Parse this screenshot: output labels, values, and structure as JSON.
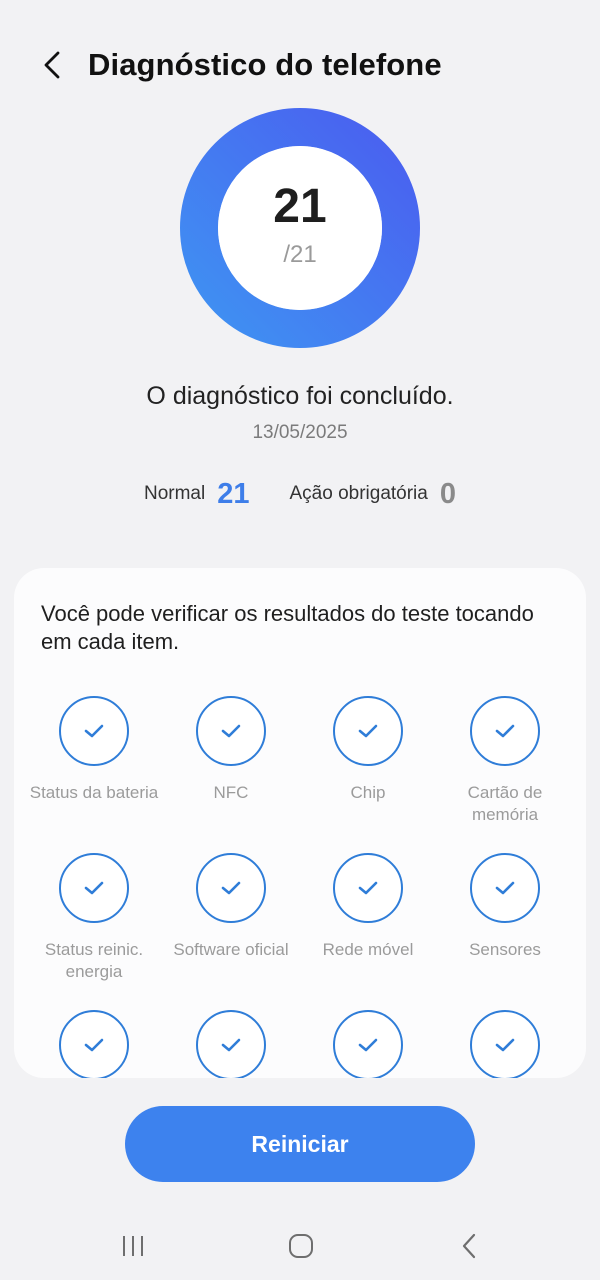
{
  "header": {
    "title": "Diagnóstico do telefone",
    "back_icon": "chevron-left-icon"
  },
  "summary": {
    "score": "21",
    "total": "/21",
    "progress": 1.0,
    "status": "O diagnóstico foi concluído.",
    "date": "13/05/2025",
    "normal_label": "Normal",
    "normal_count": "21",
    "action_label": "Ação obrigatória",
    "action_count": "0"
  },
  "results": {
    "description": "Você pode verificar os resultados do teste tocando em cada item.",
    "items": [
      {
        "label": "Status da bateria",
        "status": "ok"
      },
      {
        "label": "NFC",
        "status": "ok"
      },
      {
        "label": "Chip",
        "status": "ok"
      },
      {
        "label": "Cartão de memória",
        "status": "ok"
      },
      {
        "label": "Status reinic. energia",
        "status": "ok"
      },
      {
        "label": "Software oficial",
        "status": "ok"
      },
      {
        "label": "Rede móvel",
        "status": "ok"
      },
      {
        "label": "Sensores",
        "status": "ok"
      },
      {
        "label": "",
        "status": "ok"
      },
      {
        "label": "",
        "status": "ok"
      },
      {
        "label": "",
        "status": "ok"
      },
      {
        "label": "",
        "status": "ok"
      }
    ]
  },
  "actions": {
    "restart_label": "Reiniciar"
  },
  "colors": {
    "accent": "#3d82ee",
    "ring_start": "#3f8cf0",
    "ring_end": "#4a63ee",
    "check": "#2f7dd8"
  },
  "navbar": {
    "recents_icon": "recents-icon",
    "home_icon": "home-icon",
    "back_icon": "back-icon"
  }
}
